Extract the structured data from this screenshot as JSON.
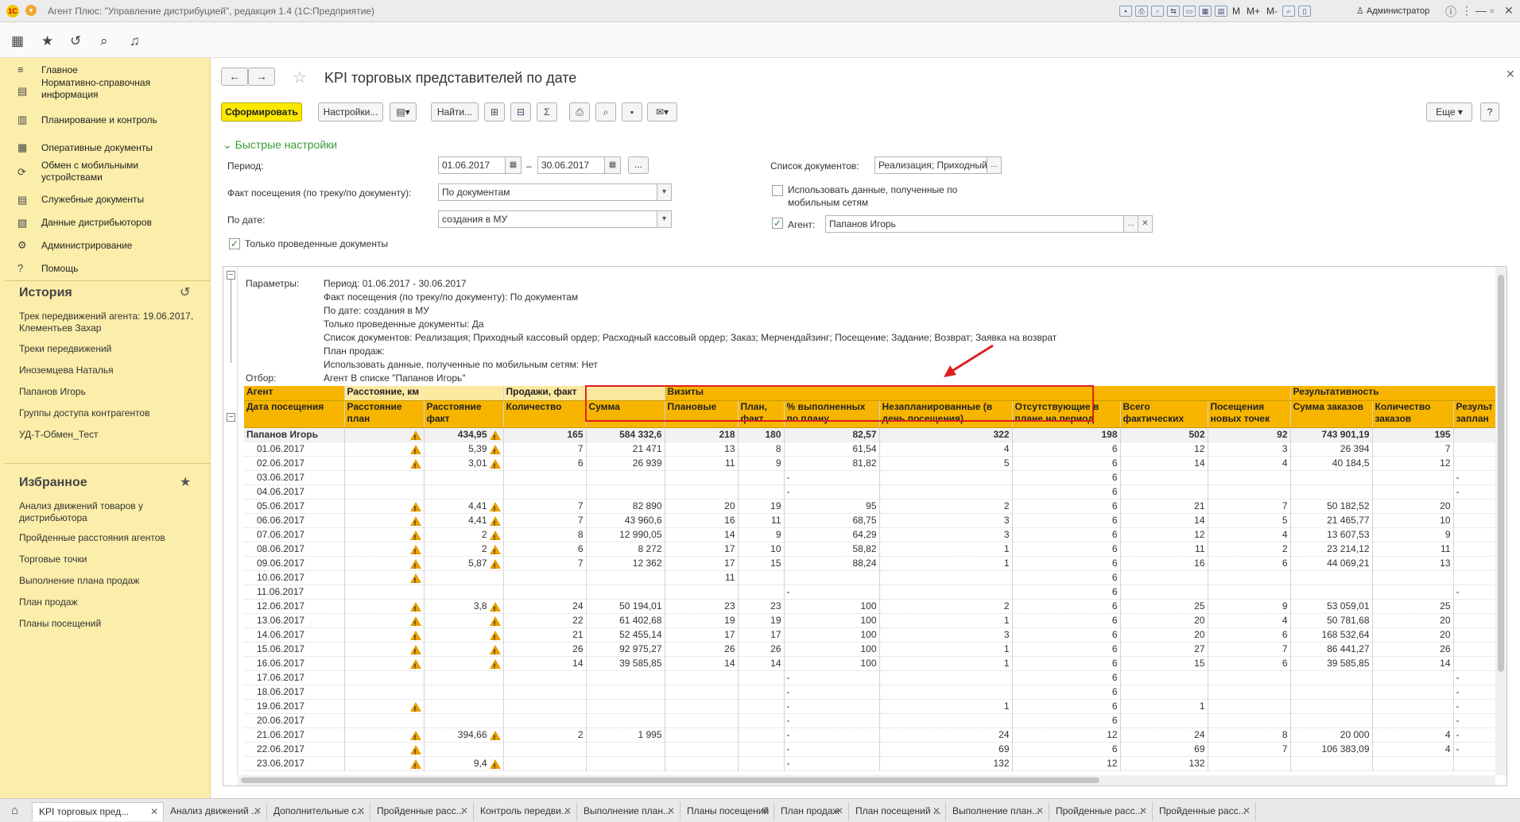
{
  "titlebar": {
    "app_title": "Агент Плюс: \"Управление дистрибуцией\", редакция 1.4  (1С:Предприятие)",
    "m": "M",
    "mplus": "M+",
    "mminus": "M-",
    "user": "Администратор"
  },
  "sidebar": {
    "items": [
      {
        "icon": "≡",
        "label": "Главное"
      },
      {
        "icon": "▤",
        "label": "Нормативно-справочная информация"
      },
      {
        "icon": "▥",
        "label": "Планирование и контроль"
      },
      {
        "icon": "▦",
        "label": "Оперативные документы"
      },
      {
        "icon": "⟳",
        "label": "Обмен с мобильными устройствами"
      },
      {
        "icon": "▤",
        "label": "Служебные документы"
      },
      {
        "icon": "▧",
        "label": "Данные дистрибьюторов"
      },
      {
        "icon": "⚙",
        "label": "Администрирование"
      },
      {
        "icon": "?",
        "label": "Помощь"
      }
    ],
    "history_title": "История",
    "history": [
      "Трек передвижений агента: 19.06.2017, Клементьев Захар",
      "Треки передвижений",
      "Иноземцева Наталья",
      "Папанов Игорь",
      "Группы доступа контрагентов",
      "УД-Т-Обмен_Тест"
    ],
    "favorites_title": "Избранное",
    "favorites": [
      "Анализ движений товаров у дистрибьютора",
      "Пройденные расстояния агентов",
      "Торговые точки",
      "Выполнение плана продаж",
      "План продаж",
      "Планы посещений"
    ]
  },
  "form": {
    "title": "KPI торговых представителей по дате",
    "generate": "Сформировать",
    "settings": "Настройки...",
    "find": "Найти...",
    "more": "Еще",
    "help": "?",
    "quick_settings": "Быстрые настройки",
    "period_label": "Период:",
    "date_from": "01.06.2017",
    "date_to": "30.06.2017",
    "dash": "–",
    "ellipsis": "...",
    "fact_label": "Факт посещения (по треку/по документу):",
    "fact_value": "По документам",
    "bydate_label": "По дате:",
    "bydate_value": "создания в МУ",
    "only_posted": "Только проведенные документы",
    "doclist_label": "Список документов:",
    "doclist_value": "Реализация; Приходный",
    "use_mobile": "Использовать данные, полученные по мобильным сетям",
    "agent_label": "Агент:",
    "agent_value": "Папанов Игорь"
  },
  "params": {
    "label": "Параметры:",
    "filter_label": "Отбор:",
    "lines": [
      "Период: 01.06.2017 - 30.06.2017",
      "Факт посещения (по треку/по документу): По документам",
      "По дате: создания в МУ",
      "Только проведенные документы: Да",
      "Список документов: Реализация; Приходный кассовый ордер; Расходный кассовый ордер; Заказ; Мерчендайзинг; Посещение; Задание; Возврат; Заявка на возврат",
      "План продаж:",
      "Использовать данные, полученные по мобильным сетям: Нет",
      "Агент В списке \"Папанов Игорь\""
    ]
  },
  "table": {
    "group_headers": [
      "Агент",
      "Расстояние, км",
      "Продажи, факт",
      "Визиты",
      "Результативность"
    ],
    "headers": [
      "Дата посещения",
      "Расстояние план",
      "Расстояние факт",
      "Количество",
      "Сумма",
      "Плановые",
      "План, факт",
      "% выполненных по плану",
      "Незапланированные (в день посещения)",
      "Отсутствующие в плане на период",
      "Всего фактических",
      "Посещения новых точек",
      "Сумма заказов",
      "Количество заказов",
      "Результ заплан"
    ],
    "total": {
      "name": "Папанов Игорь",
      "dist_fact": "434,95",
      "qty": "165",
      "sum": "584 332,6",
      "plan": "218",
      "planfact": "180",
      "pct": "82,57",
      "unpl": "322",
      "abs": "198",
      "all": "502",
      "new": "92",
      "osum": "743 901,19",
      "ocnt": "195"
    },
    "rows": [
      {
        "d": "01.06.2017",
        "w1": true,
        "df": "5,39",
        "w2": true,
        "q": "7",
        "s": "21 471",
        "p": "13",
        "pf": "8",
        "pct": "61,54",
        "u": "4",
        "a": "6",
        "t": "12",
        "n": "3",
        "os": "26 394",
        "oc": "7",
        "r": ""
      },
      {
        "d": "02.06.2017",
        "w1": true,
        "df": "3,01",
        "w2": true,
        "q": "6",
        "s": "26 939",
        "p": "11",
        "pf": "9",
        "pct": "81,82",
        "u": "5",
        "a": "6",
        "t": "14",
        "n": "4",
        "os": "40 184,5",
        "oc": "12",
        "r": ""
      },
      {
        "d": "03.06.2017",
        "w1": false,
        "df": "",
        "w2": false,
        "q": "",
        "s": "",
        "p": "",
        "pf": "",
        "pct": "-",
        "u": "",
        "a": "6",
        "t": "",
        "n": "",
        "os": "",
        "oc": "",
        "r": "-"
      },
      {
        "d": "04.06.2017",
        "w1": false,
        "df": "",
        "w2": false,
        "q": "",
        "s": "",
        "p": "",
        "pf": "",
        "pct": "-",
        "u": "",
        "a": "6",
        "t": "",
        "n": "",
        "os": "",
        "oc": "",
        "r": "-"
      },
      {
        "d": "05.06.2017",
        "w1": true,
        "df": "4,41",
        "w2": true,
        "q": "7",
        "s": "82 890",
        "p": "20",
        "pf": "19",
        "pct": "95",
        "u": "2",
        "a": "6",
        "t": "21",
        "n": "7",
        "os": "50 182,52",
        "oc": "20",
        "r": ""
      },
      {
        "d": "06.06.2017",
        "w1": true,
        "df": "4,41",
        "w2": true,
        "q": "7",
        "s": "43 960,6",
        "p": "16",
        "pf": "11",
        "pct": "68,75",
        "u": "3",
        "a": "6",
        "t": "14",
        "n": "5",
        "os": "21 465,77",
        "oc": "10",
        "r": ""
      },
      {
        "d": "07.06.2017",
        "w1": true,
        "df": "2",
        "w2": true,
        "q": "8",
        "s": "12 990,05",
        "p": "14",
        "pf": "9",
        "pct": "64,29",
        "u": "3",
        "a": "6",
        "t": "12",
        "n": "4",
        "os": "13 607,53",
        "oc": "9",
        "r": ""
      },
      {
        "d": "08.06.2017",
        "w1": true,
        "df": "2",
        "w2": true,
        "q": "6",
        "s": "8 272",
        "p": "17",
        "pf": "10",
        "pct": "58,82",
        "u": "1",
        "a": "6",
        "t": "11",
        "n": "2",
        "os": "23 214,12",
        "oc": "11",
        "r": ""
      },
      {
        "d": "09.06.2017",
        "w1": true,
        "df": "5,87",
        "w2": true,
        "q": "7",
        "s": "12 362",
        "p": "17",
        "pf": "15",
        "pct": "88,24",
        "u": "1",
        "a": "6",
        "t": "16",
        "n": "6",
        "os": "44 069,21",
        "oc": "13",
        "r": ""
      },
      {
        "d": "10.06.2017",
        "w1": true,
        "df": "",
        "w2": false,
        "q": "",
        "s": "",
        "p": "11",
        "pf": "",
        "pct": "",
        "u": "",
        "a": "6",
        "t": "",
        "n": "",
        "os": "",
        "oc": "",
        "r": ""
      },
      {
        "d": "11.06.2017",
        "w1": false,
        "df": "",
        "w2": false,
        "q": "",
        "s": "",
        "p": "",
        "pf": "",
        "pct": "-",
        "u": "",
        "a": "6",
        "t": "",
        "n": "",
        "os": "",
        "oc": "",
        "r": "-"
      },
      {
        "d": "12.06.2017",
        "w1": true,
        "df": "3,8",
        "w2": true,
        "q": "24",
        "s": "50 194,01",
        "p": "23",
        "pf": "23",
        "pct": "100",
        "u": "2",
        "a": "6",
        "t": "25",
        "n": "9",
        "os": "53 059,01",
        "oc": "25",
        "r": ""
      },
      {
        "d": "13.06.2017",
        "w1": true,
        "df": "",
        "w2": true,
        "q": "22",
        "s": "61 402,68",
        "p": "19",
        "pf": "19",
        "pct": "100",
        "u": "1",
        "a": "6",
        "t": "20",
        "n": "4",
        "os": "50 781,68",
        "oc": "20",
        "r": ""
      },
      {
        "d": "14.06.2017",
        "w1": true,
        "df": "",
        "w2": true,
        "q": "21",
        "s": "52 455,14",
        "p": "17",
        "pf": "17",
        "pct": "100",
        "u": "3",
        "a": "6",
        "t": "20",
        "n": "6",
        "os": "168 532,64",
        "oc": "20",
        "r": ""
      },
      {
        "d": "15.06.2017",
        "w1": true,
        "df": "",
        "w2": true,
        "q": "26",
        "s": "92 975,27",
        "p": "26",
        "pf": "26",
        "pct": "100",
        "u": "1",
        "a": "6",
        "t": "27",
        "n": "7",
        "os": "86 441,27",
        "oc": "26",
        "r": ""
      },
      {
        "d": "16.06.2017",
        "w1": true,
        "df": "",
        "w2": true,
        "q": "14",
        "s": "39 585,85",
        "p": "14",
        "pf": "14",
        "pct": "100",
        "u": "1",
        "a": "6",
        "t": "15",
        "n": "6",
        "os": "39 585,85",
        "oc": "14",
        "r": ""
      },
      {
        "d": "17.06.2017",
        "w1": false,
        "df": "",
        "w2": false,
        "q": "",
        "s": "",
        "p": "",
        "pf": "",
        "pct": "-",
        "u": "",
        "a": "6",
        "t": "",
        "n": "",
        "os": "",
        "oc": "",
        "r": "-"
      },
      {
        "d": "18.06.2017",
        "w1": false,
        "df": "",
        "w2": false,
        "q": "",
        "s": "",
        "p": "",
        "pf": "",
        "pct": "-",
        "u": "",
        "a": "6",
        "t": "",
        "n": "",
        "os": "",
        "oc": "",
        "r": "-"
      },
      {
        "d": "19.06.2017",
        "w1": true,
        "df": "",
        "w2": false,
        "q": "",
        "s": "",
        "p": "",
        "pf": "",
        "pct": "-",
        "u": "1",
        "a": "6",
        "t": "1",
        "n": "",
        "os": "",
        "oc": "",
        "r": "-"
      },
      {
        "d": "20.06.2017",
        "w1": false,
        "df": "",
        "w2": false,
        "q": "",
        "s": "",
        "p": "",
        "pf": "",
        "pct": "-",
        "u": "",
        "a": "6",
        "t": "",
        "n": "",
        "os": "",
        "oc": "",
        "r": "-"
      },
      {
        "d": "21.06.2017",
        "w1": true,
        "df": "394,66",
        "w2": true,
        "q": "2",
        "s": "1 995",
        "p": "",
        "pf": "",
        "pct": "-",
        "u": "24",
        "a": "12",
        "t": "24",
        "n": "8",
        "os": "20 000",
        "oc": "4",
        "r": "-"
      },
      {
        "d": "22.06.2017",
        "w1": true,
        "df": "",
        "w2": false,
        "q": "",
        "s": "",
        "p": "",
        "pf": "",
        "pct": "-",
        "u": "69",
        "a": "6",
        "t": "69",
        "n": "7",
        "os": "106 383,09",
        "oc": "4",
        "r": "-"
      },
      {
        "d": "23.06.2017",
        "w1": true,
        "df": "9,4",
        "w2": true,
        "q": "",
        "s": "",
        "p": "",
        "pf": "",
        "pct": "-",
        "u": "132",
        "a": "12",
        "t": "132",
        "n": "",
        "os": "",
        "oc": "",
        "r": ""
      }
    ]
  },
  "tabs": [
    "KPI торговых пред...",
    "Анализ движений ...",
    "Дополнительные с...",
    "Пройденные расс...",
    "Контроль передви...",
    "Выполнение план...",
    "Планы посещений",
    "План продаж",
    "План посещений ...",
    "Выполнение план...",
    "Пройденные расс...",
    "Пройденные расс..."
  ],
  "colors": {
    "sidebar": "#fbeeaa",
    "primary_button": "#fce800",
    "header": "#f7b500",
    "highlight": "#e02020",
    "accent_green": "#3a9a3a"
  }
}
